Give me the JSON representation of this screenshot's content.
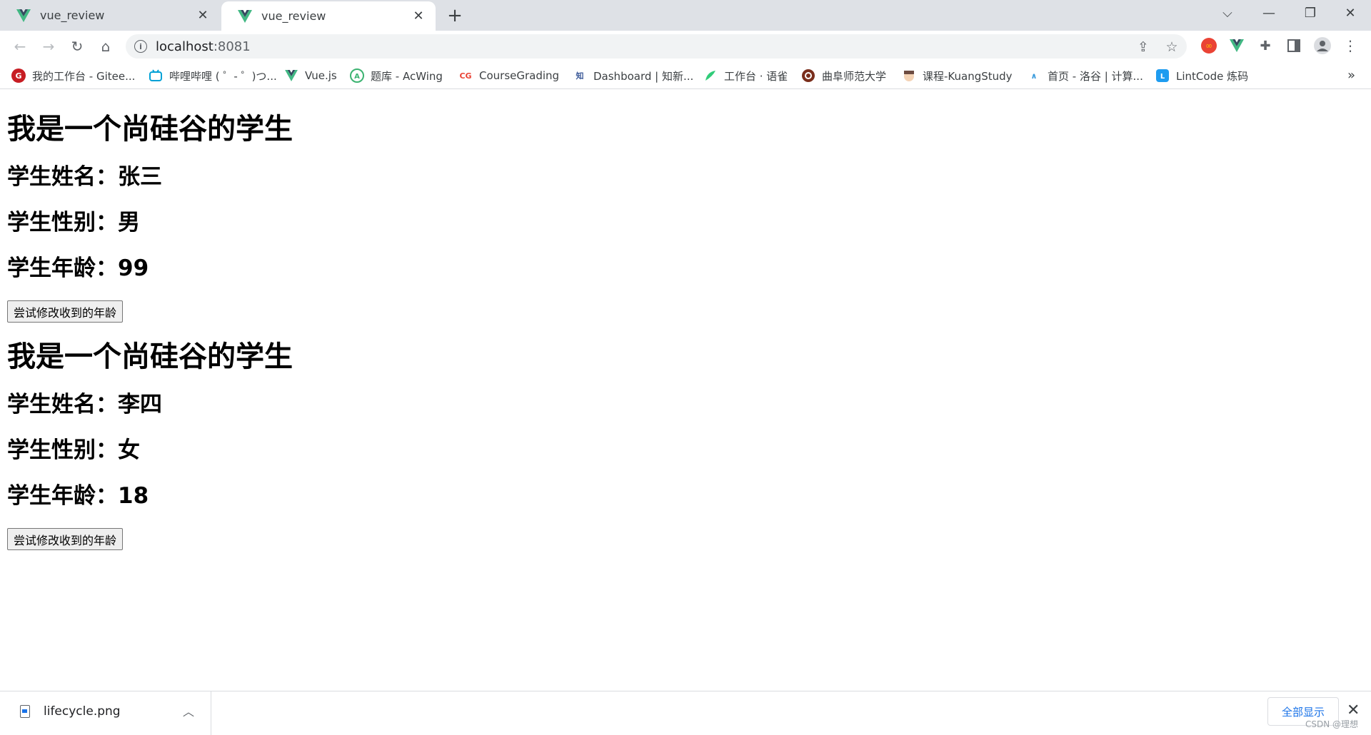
{
  "tabs": [
    {
      "title": "vue_review",
      "active": false
    },
    {
      "title": "vue_review",
      "active": true
    }
  ],
  "toolbar": {
    "url_host": "localhost",
    "url_port": ":8081"
  },
  "bookmarks": [
    {
      "label": "我的工作台 - Gitee...",
      "icon": "gitee-icon",
      "color": "#c71d23"
    },
    {
      "label": "哔哩哔哩 ( ゜- ゜)つ...",
      "icon": "bilibili-icon",
      "color": "#00a1d6"
    },
    {
      "label": "Vue.js",
      "icon": "vue-icon",
      "color": "#41b883"
    },
    {
      "label": "题库 - AcWing",
      "icon": "acwing-icon",
      "color": "#3cb371"
    },
    {
      "label": "CourseGrading",
      "icon": "coursegrading-icon",
      "color": "#1a73e8"
    },
    {
      "label": "Dashboard | 知新...",
      "icon": "dashboard-icon",
      "color": "#3b5998"
    },
    {
      "label": "工作台 · 语雀",
      "icon": "yuque-icon",
      "color": "#31cc79"
    },
    {
      "label": "曲阜师范大学",
      "icon": "qfnu-icon",
      "color": "#7a2e1c"
    },
    {
      "label": "课程-KuangStudy",
      "icon": "kuangstudy-icon",
      "color": "#8d6e63"
    },
    {
      "label": "首页 - 洛谷 | 计算...",
      "icon": "luogu-icon",
      "color": "#3498db"
    },
    {
      "label": "LintCode 炼码",
      "icon": "lintcode-icon",
      "color": "#1e9cf0"
    }
  ],
  "students": [
    {
      "heading": "我是一个尚硅谷的学生",
      "name_line": "学生姓名：张三",
      "sex_line": "学生性别：男",
      "age_line": "学生年龄：99",
      "button_label": "尝试修改收到的年龄"
    },
    {
      "heading": "我是一个尚硅谷的学生",
      "name_line": "学生姓名：李四",
      "sex_line": "学生性别：女",
      "age_line": "学生年龄：18",
      "button_label": "尝试修改收到的年龄"
    }
  ],
  "downloads": {
    "file_name": "lifecycle.png",
    "show_all_label": "全部显示"
  },
  "watermark": "CSDN @理想"
}
